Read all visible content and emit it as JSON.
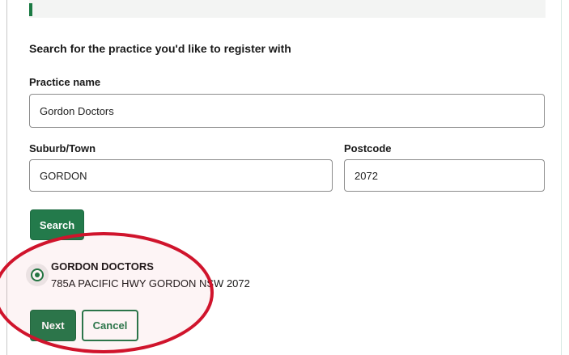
{
  "form": {
    "heading": "Search for the practice you'd like to register with",
    "practice_name": {
      "label": "Practice name",
      "value": "Gordon Doctors"
    },
    "suburb": {
      "label": "Suburb/Town",
      "value": "GORDON"
    },
    "postcode": {
      "label": "Postcode",
      "value": "2072"
    },
    "search_label": "Search"
  },
  "results": [
    {
      "name": "GORDON DOCTORS",
      "address": "785A PACIFIC HWY GORDON NSW 2072",
      "selected": true
    }
  ],
  "actions": {
    "next_label": "Next",
    "cancel_label": "Cancel"
  },
  "colors": {
    "primary": "#237a4b",
    "annotation": "#d0142c"
  }
}
